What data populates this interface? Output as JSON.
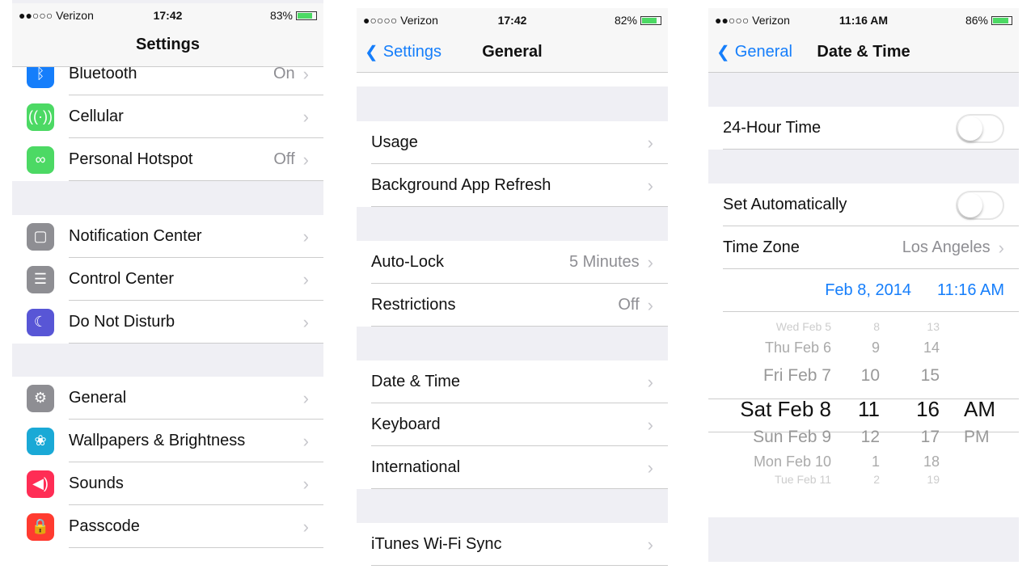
{
  "panel1": {
    "status": {
      "carrier": "●●○○○ Verizon",
      "time": "17:42",
      "battery": "83%",
      "battery_level": 0.83
    },
    "title": "Settings",
    "items": [
      {
        "label": "Bluetooth",
        "value": "On",
        "icon": "bluetooth-icon",
        "color": "#157efb"
      },
      {
        "label": "Cellular",
        "value": "",
        "icon": "cellular-icon",
        "color": "#4cd964"
      },
      {
        "label": "Personal Hotspot",
        "value": "Off",
        "icon": "hotspot-icon",
        "color": "#4cd964"
      },
      {
        "label": "Notification Center",
        "value": "",
        "icon": "notification-icon",
        "color": "#8e8e93"
      },
      {
        "label": "Control Center",
        "value": "",
        "icon": "control-center-icon",
        "color": "#8e8e93"
      },
      {
        "label": "Do Not Disturb",
        "value": "",
        "icon": "moon-icon",
        "color": "#5856d6"
      },
      {
        "label": "General",
        "value": "",
        "icon": "gear-icon",
        "color": "#8e8e93"
      },
      {
        "label": "Wallpapers & Brightness",
        "value": "",
        "icon": "wallpaper-icon",
        "color": "#1aa9d6"
      },
      {
        "label": "Sounds",
        "value": "",
        "icon": "speaker-icon",
        "color": "#ff2d55"
      },
      {
        "label": "Passcode",
        "value": "",
        "icon": "lock-icon",
        "color": "#ff3b30"
      }
    ]
  },
  "panel2": {
    "status": {
      "carrier": "●○○○○ Verizon",
      "time": "17:42",
      "battery": "82%",
      "battery_level": 0.82
    },
    "back": "Settings",
    "title": "General",
    "items": [
      {
        "label": "Usage",
        "value": ""
      },
      {
        "label": "Background App Refresh",
        "value": ""
      },
      {
        "label": "Auto-Lock",
        "value": "5 Minutes"
      },
      {
        "label": "Restrictions",
        "value": "Off"
      },
      {
        "label": "Date & Time",
        "value": ""
      },
      {
        "label": "Keyboard",
        "value": ""
      },
      {
        "label": "International",
        "value": ""
      },
      {
        "label": "iTunes Wi-Fi Sync",
        "value": ""
      }
    ]
  },
  "panel3": {
    "status": {
      "carrier": "●●○○○ Verizon",
      "time": "11:16 AM",
      "battery": "86%",
      "battery_level": 0.86
    },
    "back": "General",
    "title": "Date & Time",
    "hour24": {
      "label": "24-Hour Time",
      "on": false
    },
    "auto": {
      "label": "Set Automatically",
      "on": false
    },
    "timezone": {
      "label": "Time Zone",
      "value": "Los Angeles"
    },
    "date": "Feb 8, 2014",
    "time": "11:16 AM",
    "picker": {
      "days": [
        "Wed Feb 5",
        "Thu Feb 6",
        "Fri Feb 7",
        "Sat Feb 8",
        "Sun Feb 9",
        "Mon Feb 10",
        "Tue Feb 11"
      ],
      "hours": [
        "8",
        "9",
        "10",
        "11",
        "12",
        "1",
        "2"
      ],
      "minutes": [
        "13",
        "14",
        "15",
        "16",
        "17",
        "18",
        "19"
      ],
      "ampm": [
        "AM",
        "PM"
      ],
      "selected_index": 3
    }
  }
}
